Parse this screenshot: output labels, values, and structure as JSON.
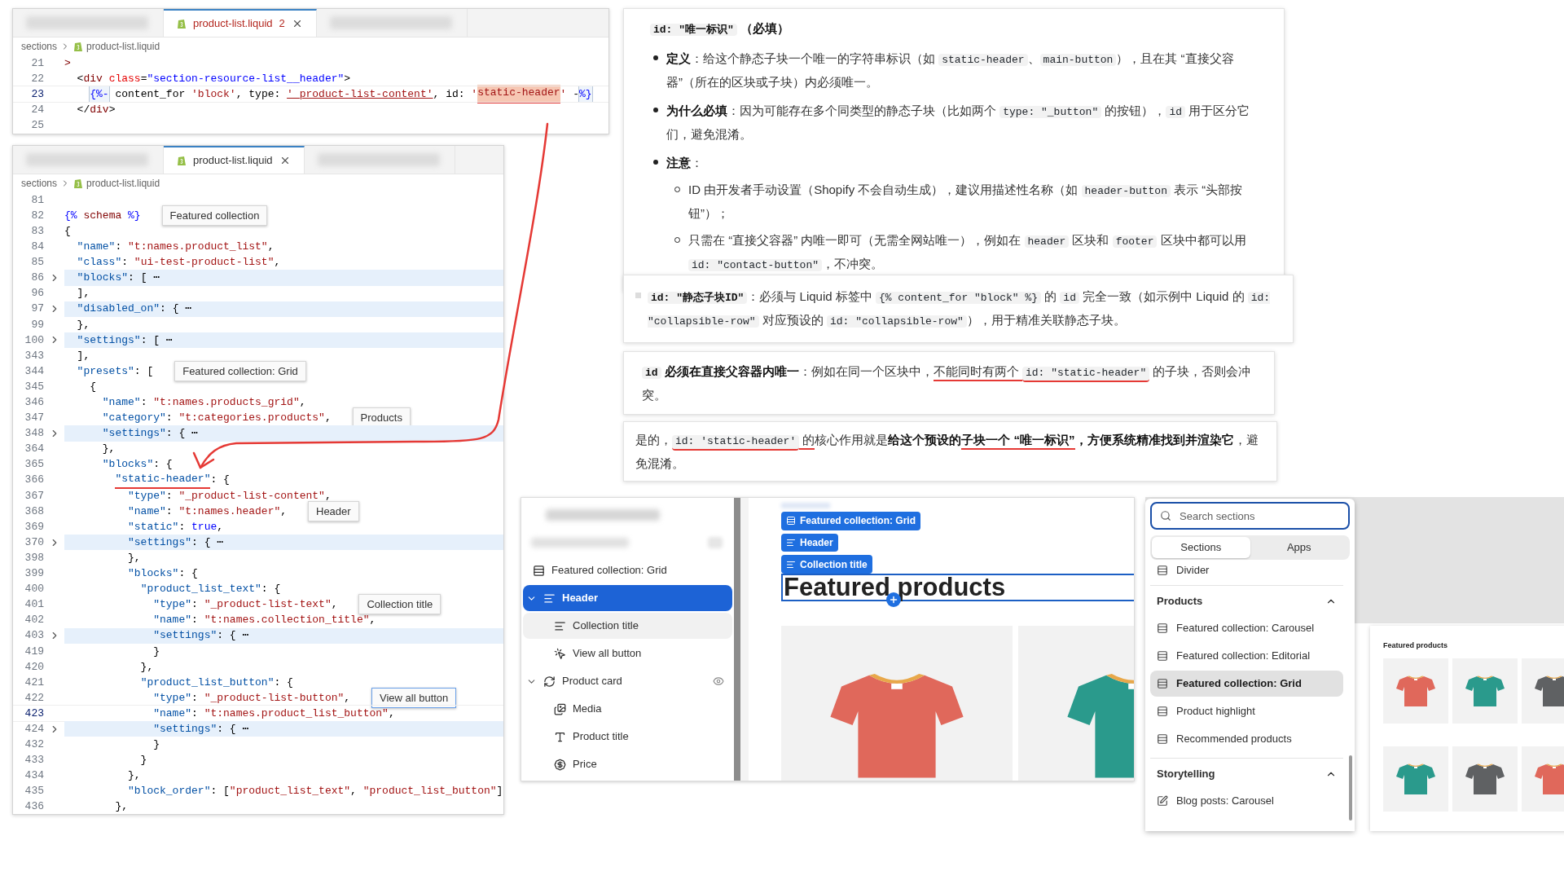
{
  "code_editors": [
    {
      "tabs": [
        {
          "kind": "blurred",
          "selected": false
        },
        {
          "kind": "file",
          "label": "product-list.liquid",
          "badge": "2",
          "selected": true
        },
        {
          "kind": "blurred",
          "selected": false
        }
      ],
      "breadcrumb": [
        "sections",
        "product-list.liquid"
      ],
      "lines": [
        {
          "num": "21",
          "current": false,
          "segments": [
            {
              "kind": "tag",
              "t": ">"
            }
          ]
        },
        {
          "num": "22",
          "current": false,
          "segments": [
            {
              "kind": "plain",
              "t": "  <"
            },
            {
              "kind": "tag",
              "t": "div"
            },
            {
              "kind": "attr",
              "t": " class"
            },
            {
              "kind": "plain",
              "t": "="
            },
            {
              "kind": "value",
              "t": "\"section-resource-list__header\""
            },
            {
              "kind": "plain",
              "t": ">"
            }
          ]
        },
        {
          "num": "23",
          "current": true,
          "segments": [
            {
              "kind": "delim",
              "t": "    {%-"
            },
            {
              "kind": "plain",
              "t": " content_for "
            },
            {
              "kind": "string",
              "t": "'block'"
            },
            {
              "kind": "plain",
              "t": ", type: "
            },
            {
              "kind": "link",
              "t": "'_product-list-content'"
            },
            {
              "kind": "plain",
              "t": ", id: "
            },
            {
              "kind": "string",
              "t": "'"
            },
            {
              "kind": "highlight",
              "t": "static-header",
              "annotated": true
            },
            {
              "kind": "string",
              "t": "'"
            },
            {
              "kind": "plain",
              "t": " -"
            },
            {
              "kind": "delim",
              "t": "%}"
            }
          ]
        },
        {
          "num": "24",
          "current": false,
          "segments": [
            {
              "kind": "plain",
              "t": "  </"
            },
            {
              "kind": "tag",
              "t": "div"
            },
            {
              "kind": "plain",
              "t": ">"
            }
          ]
        },
        {
          "num": "25",
          "current": false
        }
      ]
    },
    {
      "tabs": [
        {
          "kind": "blurred",
          "selected": false
        },
        {
          "kind": "file",
          "label": "product-list.liquid",
          "selected": true
        },
        {
          "kind": "blurred",
          "selected": false
        }
      ],
      "breadcrumb": [
        "sections",
        "product-list.liquid"
      ],
      "lines": [
        {
          "num": "81",
          "current": false
        },
        {
          "num": "82",
          "current": false,
          "text": "{% schema %}",
          "hint": {
            "label": "Featured collection",
            "focused": false
          }
        },
        {
          "num": "83",
          "current": false,
          "text": "{"
        },
        {
          "num": "84",
          "current": false,
          "text": "  \"name\": \"t:names.product_list\","
        },
        {
          "num": "85",
          "current": false,
          "text": "  \"class\": \"ui-test-product-list\","
        },
        {
          "num": "86",
          "current": false,
          "text": "  \"blocks\": [ ⋯",
          "folded": true
        },
        {
          "num": "96",
          "current": false,
          "text": "  ],"
        },
        {
          "num": "97",
          "current": false,
          "text": "  \"disabled_on\": { ⋯",
          "folded": true
        },
        {
          "num": "99",
          "current": false,
          "text": "  },"
        },
        {
          "num": "100",
          "current": false,
          "text": "  \"settings\": [ ⋯",
          "folded": true
        },
        {
          "num": "343",
          "current": false,
          "text": "  ],"
        },
        {
          "num": "344",
          "current": false,
          "text": "  \"presets\": [",
          "hint": {
            "label": "Featured collection: Grid",
            "focused": false
          }
        },
        {
          "num": "345",
          "current": false,
          "text": "    {"
        },
        {
          "num": "346",
          "current": false,
          "text": "      \"name\": \"t:names.products_grid\","
        },
        {
          "num": "347",
          "current": false,
          "text": "      \"category\": \"t:categories.products\",",
          "hint": {
            "label": "Products",
            "focused": false
          }
        },
        {
          "num": "348",
          "current": false,
          "text": "      \"settings\": { ⋯",
          "folded": true
        },
        {
          "num": "364",
          "current": false,
          "text": "      },"
        },
        {
          "num": "365",
          "current": false,
          "text": "      \"blocks\": {"
        },
        {
          "num": "366",
          "current": false,
          "text": "        \"static-header\": {",
          "annotated": true
        },
        {
          "num": "367",
          "current": false,
          "text": "          \"type\": \"_product-list-content\","
        },
        {
          "num": "368",
          "current": false,
          "text": "          \"name\": \"t:names.header\",",
          "hint": {
            "label": "Header",
            "focused": false
          }
        },
        {
          "num": "369",
          "current": false,
          "text": "          \"static\": true,"
        },
        {
          "num": "370",
          "current": false,
          "text": "          \"settings\": { ⋯",
          "folded": true
        },
        {
          "num": "398",
          "current": false,
          "text": "          },"
        },
        {
          "num": "399",
          "current": false,
          "text": "          \"blocks\": {"
        },
        {
          "num": "400",
          "current": false,
          "text": "            \"product_list_text\": {"
        },
        {
          "num": "401",
          "current": false,
          "text": "              \"type\": \"_product-list-text\",",
          "hint": {
            "label": "Collection title",
            "focused": false
          }
        },
        {
          "num": "402",
          "current": false,
          "text": "              \"name\": \"t:names.collection_title\","
        },
        {
          "num": "403",
          "current": false,
          "text": "              \"settings\": { ⋯",
          "folded": true
        },
        {
          "num": "419",
          "current": false,
          "text": "              }"
        },
        {
          "num": "420",
          "current": false,
          "text": "            },"
        },
        {
          "num": "421",
          "current": false,
          "text": "            \"product_list_button\": {"
        },
        {
          "num": "422",
          "current": false,
          "text": "              \"type\": \"_product-list-button\",",
          "hint": {
            "label": "View all button",
            "focused": true
          }
        },
        {
          "num": "423",
          "current": true,
          "text": "              \"name\": \"t:names.product_list_button\","
        },
        {
          "num": "424",
          "current": false,
          "text": "              \"settings\": { ⋯",
          "folded": true
        },
        {
          "num": "432",
          "current": false,
          "text": "              }"
        },
        {
          "num": "433",
          "current": false,
          "text": "            }"
        },
        {
          "num": "434",
          "current": false,
          "text": "          },"
        },
        {
          "num": "435",
          "current": false,
          "text": "          \"block_order\": [\"product_list_text\", \"product_list_button\"]"
        },
        {
          "num": "436",
          "current": false,
          "text": "        },"
        }
      ]
    }
  ],
  "notes": [
    {
      "blocks": [
        {
          "kind": "heading",
          "segments": [
            {
              "t": "id: \"唯一标识\"",
              "kind": "bold-code"
            },
            {
              "t": " （必填）",
              "kind": "bold"
            }
          ]
        },
        {
          "kind": "bullet",
          "segments": [
            {
              "t": "定义",
              "kind": "bold"
            },
            {
              "t": "：给这个静态子块一个唯一的字符串标识（如 ",
              "kind": "text"
            },
            {
              "t": "static-header",
              "kind": "code"
            },
            {
              "t": "、",
              "kind": "text"
            },
            {
              "t": "main-button",
              "kind": "code"
            },
            {
              "t": "），且在其 “直接父容器”（所在的区块或子块）内必须唯一。",
              "kind": "text"
            }
          ]
        },
        {
          "kind": "bullet",
          "segments": [
            {
              "t": "为什么必填",
              "kind": "bold"
            },
            {
              "t": "：因为可能存在多个同类型的静态子块（比如两个 ",
              "kind": "text"
            },
            {
              "t": "type: \"_button\"",
              "kind": "code"
            },
            {
              "t": " 的按钮），",
              "kind": "text"
            },
            {
              "t": "id",
              "kind": "code"
            },
            {
              "t": " 用于区分它们，避免混淆。",
              "kind": "text"
            }
          ]
        },
        {
          "kind": "bullet",
          "segments": [
            {
              "t": "注意",
              "kind": "bold"
            },
            {
              "t": "：",
              "kind": "text"
            }
          ],
          "children": [
            {
              "kind": "circle",
              "segments": [
                {
                  "t": "ID 由开发者手动设置（Shopify 不会自动生成），建议用描述性名称（如 ",
                  "kind": "text"
                },
                {
                  "t": "header-button",
                  "kind": "code"
                },
                {
                  "t": " 表示 “头部按钮”）；",
                  "kind": "text"
                }
              ]
            },
            {
              "kind": "circle",
              "segments": [
                {
                  "t": "只需在 “直接父容器” 内唯一即可（无需全网站唯一），例如在 ",
                  "kind": "text"
                },
                {
                  "t": "header",
                  "kind": "code"
                },
                {
                  "t": " 区块和 ",
                  "kind": "text"
                },
                {
                  "t": "footer",
                  "kind": "code"
                },
                {
                  "t": " 区块中都可以用 ",
                  "kind": "text"
                },
                {
                  "t": "id: \"contact-button\"",
                  "kind": "code"
                },
                {
                  "t": "，不冲突。",
                  "kind": "text"
                }
              ]
            }
          ]
        }
      ]
    },
    {
      "blocks": [
        {
          "kind": "square",
          "segments": [
            {
              "t": "id: \"静态子块ID\"",
              "kind": "bold-code"
            },
            {
              "t": "：必须与 Liquid 标签中 ",
              "kind": "text"
            },
            {
              "t": "{% content_for \"block\" %}",
              "kind": "code"
            },
            {
              "t": " 的 ",
              "kind": "text"
            },
            {
              "t": "id",
              "kind": "code"
            },
            {
              "t": " 完全一致（如示例中 Liquid 的 ",
              "kind": "text"
            },
            {
              "t": "id: \"collapsible-row\"",
              "kind": "code"
            },
            {
              "t": " 对应预设的 ",
              "kind": "text"
            },
            {
              "t": "id: \"collapsible-row\"",
              "kind": "code"
            },
            {
              "t": "），用于精准关联静态子块。",
              "kind": "text"
            }
          ]
        }
      ]
    },
    {
      "blocks": [
        {
          "kind": "paragraph",
          "segments": [
            {
              "t": "id",
              "kind": "bold-code",
              "underlined": false
            },
            {
              "t": " 必须在直接父容器内唯一",
              "kind": "bold",
              "underlined": false
            },
            {
              "t": "：例如在同一个区块中，",
              "kind": "text",
              "underlined": false
            },
            {
              "t": "不能同时有两个 ",
              "kind": "text",
              "underlined": true
            },
            {
              "t": "id: \"static-header\"",
              "kind": "code",
              "underlined": true
            },
            {
              "t": " 的子块，否则会冲突。",
              "kind": "text",
              "underlined": false
            }
          ]
        }
      ]
    },
    {
      "blocks": [
        {
          "kind": "paragraph",
          "segments": [
            {
              "t": "是的，",
              "kind": "text",
              "underlined": false
            },
            {
              "t": "id: 'static-header'",
              "kind": "code",
              "underlined": true
            },
            {
              "t": " 的",
              "kind": "text",
              "underlined": true
            },
            {
              "t": "核心作用就是",
              "kind": "text",
              "underlined": false
            },
            {
              "t": "给这个预设的",
              "kind": "bold",
              "underlined": false
            },
            {
              "t": "子块一个 “唯一标识”",
              "kind": "bold",
              "underlined": true
            },
            {
              "t": "，方便系统精准找到并渲染它",
              "kind": "bold",
              "underlined": false
            },
            {
              "t": "，避免混淆。",
              "kind": "text",
              "underlined": false
            }
          ]
        }
      ]
    }
  ],
  "theme_editor": {
    "tree": [
      {
        "label": "Featured collection: Grid",
        "kind": "section",
        "selected": false,
        "hovered": false,
        "children": [
          {
            "label": "Header",
            "kind": "text",
            "selected": true,
            "expanded": true,
            "children": [
              {
                "label": "Collection title",
                "kind": "text",
                "selected": false,
                "hovered": true
              },
              {
                "label": "View all button",
                "kind": "button",
                "selected": false,
                "hovered": false
              }
            ]
          },
          {
            "label": "Product card",
            "kind": "card",
            "selected": false,
            "hovered": false,
            "expanded": true,
            "visibility_toggle": true,
            "children": [
              {
                "label": "Media",
                "kind": "media",
                "selected": false,
                "hovered": false
              },
              {
                "label": "Product title",
                "kind": "title",
                "selected": false,
                "hovered": false
              },
              {
                "label": "Price",
                "kind": "price",
                "selected": false,
                "hovered": false
              }
            ]
          }
        ]
      }
    ],
    "canvas": {
      "chips": [
        {
          "label": "Featured collection: Grid",
          "kind": "section"
        },
        {
          "label": "Header",
          "kind": "text"
        },
        {
          "label": "Collection title",
          "kind": "text"
        }
      ],
      "heading": "Featured products",
      "products": [
        {
          "color": "#e0685b"
        },
        {
          "color": "#2a9a8c"
        }
      ]
    }
  },
  "sections_panel": {
    "search": {
      "placeholder": "Search sections"
    },
    "tabs": [
      {
        "label": "Sections",
        "selected": true
      },
      {
        "label": "Apps",
        "selected": false
      }
    ],
    "loose_items": [
      {
        "label": "Divider",
        "kind": "section",
        "selected": false
      }
    ],
    "groups": [
      {
        "title": "Products",
        "expanded": true,
        "items": [
          {
            "label": "Featured collection: Carousel",
            "kind": "section",
            "selected": false
          },
          {
            "label": "Featured collection: Editorial",
            "kind": "section",
            "selected": false
          },
          {
            "label": "Featured collection: Grid",
            "kind": "section",
            "selected": true
          },
          {
            "label": "Product highlight",
            "kind": "section",
            "selected": false
          },
          {
            "label": "Recommended products",
            "kind": "section",
            "selected": false
          }
        ]
      },
      {
        "title": "Storytelling",
        "expanded": true,
        "items": [
          {
            "label": "Blog posts: Carousel",
            "kind": "post",
            "selected": false
          }
        ]
      }
    ]
  },
  "preview_thumbnail": {
    "title": "Featured products",
    "products": [
      {
        "color": "#e0685b"
      },
      {
        "color": "#2a9a8c"
      },
      {
        "color": "#5f6163"
      },
      {
        "color": "#2a9a8c"
      },
      {
        "color": "#5f6163"
      },
      {
        "color": "#e0685b"
      }
    ]
  }
}
